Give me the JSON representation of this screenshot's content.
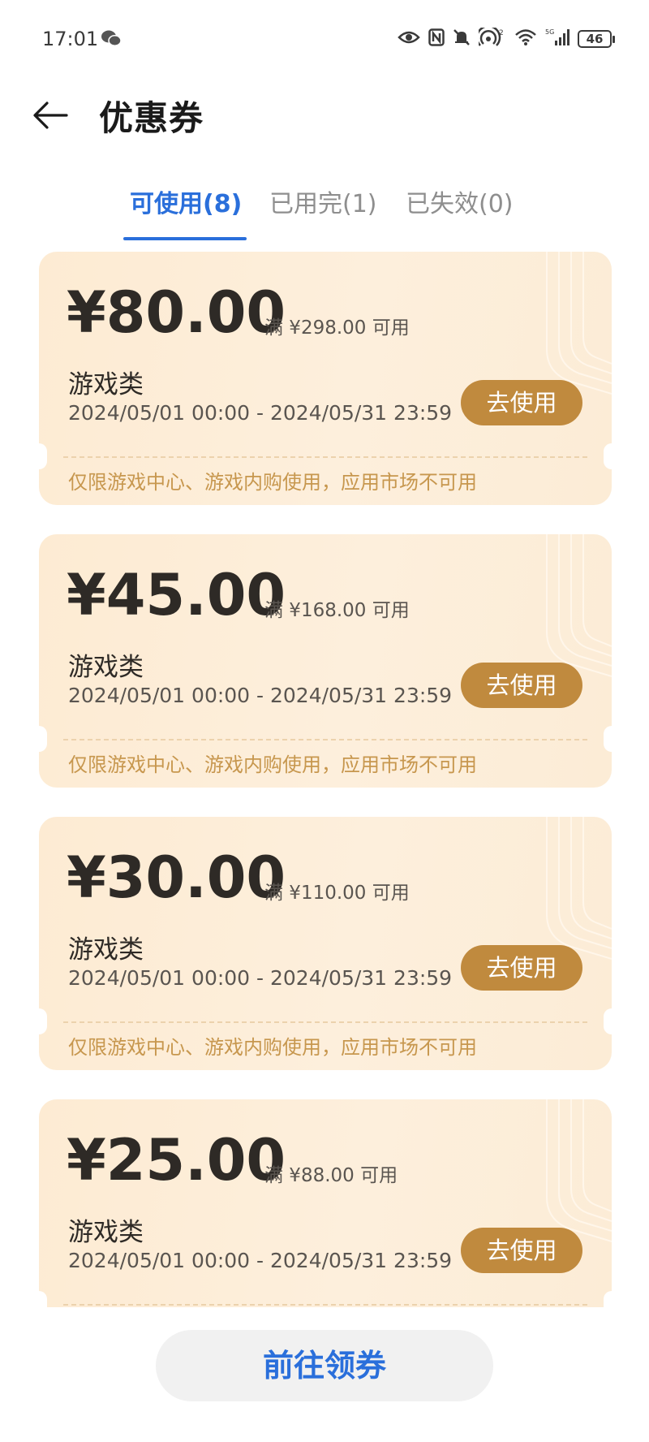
{
  "status_bar": {
    "time": "17:01",
    "signal_label": "5G",
    "hotspot_count": "2",
    "battery": "46"
  },
  "header": {
    "back_icon": "back-arrow-icon",
    "title": "优惠券"
  },
  "tabs": [
    {
      "label": "可使用(8)",
      "active": true
    },
    {
      "label": "已用完(1)",
      "active": false
    },
    {
      "label": "已失效(0)",
      "active": false
    }
  ],
  "coupons": [
    {
      "amount": "¥80.00",
      "threshold": "满 ¥298.00 可用",
      "category": "游戏类",
      "period": "2024/05/01 00:00 - 2024/05/31 23:59",
      "button": "去使用",
      "note": "仅限游戏中心、游戏内购使用，应用市场不可用"
    },
    {
      "amount": "¥45.00",
      "threshold": "满 ¥168.00 可用",
      "category": "游戏类",
      "period": "2024/05/01 00:00 - 2024/05/31 23:59",
      "button": "去使用",
      "note": "仅限游戏中心、游戏内购使用，应用市场不可用"
    },
    {
      "amount": "¥30.00",
      "threshold": "满 ¥110.00 可用",
      "category": "游戏类",
      "period": "2024/05/01 00:00 - 2024/05/31 23:59",
      "button": "去使用",
      "note": "仅限游戏中心、游戏内购使用，应用市场不可用"
    },
    {
      "amount": "¥25.00",
      "threshold": "满 ¥88.00 可用",
      "category": "游戏类",
      "period": "2024/05/01 00:00 - 2024/05/31 23:59",
      "button": "去使用",
      "note": ""
    }
  ],
  "footer": {
    "claim_label": "前往领券"
  },
  "colors": {
    "accent": "#2a6fdb",
    "button_gold": "#c08a3e",
    "coupon_bg": "#fdebd3",
    "note_text": "#c7974e"
  }
}
